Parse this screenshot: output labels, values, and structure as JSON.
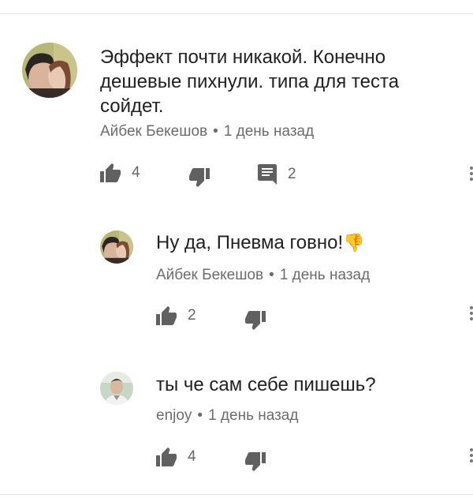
{
  "comments": [
    {
      "text": "Эффект почти никакой. Конечно дешевые пихнули. типа для теста сойдет.",
      "author": "Айбек Бекешов",
      "separator": "•",
      "time": "1 день назад",
      "likes": "4",
      "replies": "2"
    },
    {
      "text": "Ну да, Пневма говно!",
      "emoji": "👎",
      "author": "Айбек Бекешов",
      "separator": "•",
      "time": "1 день назад",
      "likes": "2"
    },
    {
      "text": "ты че сам себе пишешь?",
      "author": "enjoy",
      "separator": "•",
      "time": "1 день назад",
      "likes": "4"
    }
  ],
  "icons": {
    "like": "thumbs-up-icon",
    "dislike": "thumbs-down-icon",
    "reply": "reply-icon",
    "menu": "more-vert-icon"
  },
  "colors": {
    "text": "#212121",
    "meta": "#6c6c6c",
    "icon": "#606060",
    "emoji": "#e26aa0"
  }
}
